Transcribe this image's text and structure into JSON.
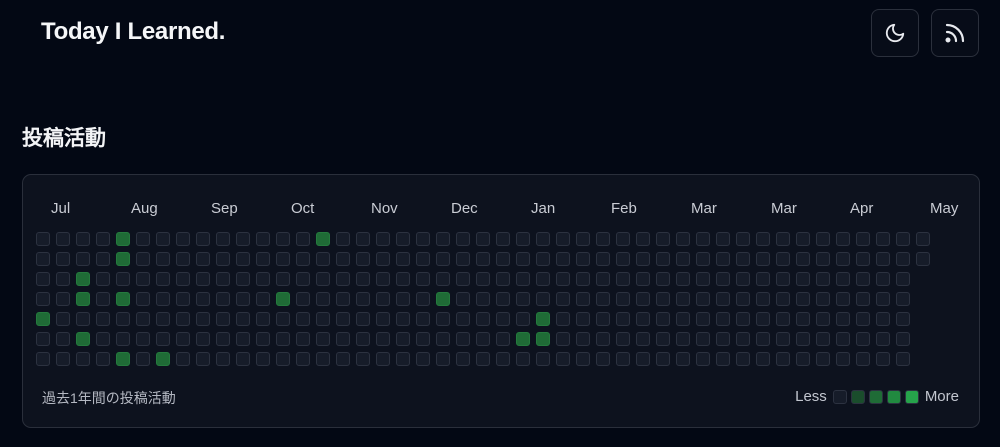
{
  "header": {
    "site_title": "Today I Learned.",
    "theme_toggle_icon": "moon-icon",
    "rss_icon": "rss-icon"
  },
  "section": {
    "title": "投稿活動"
  },
  "activity": {
    "months": [
      "Jul",
      "Aug",
      "Sep",
      "Oct",
      "Nov",
      "Dec",
      "Jan",
      "Feb",
      "Mar",
      "Mar",
      "Apr",
      "May"
    ],
    "caption": "過去1年間の投稿活動",
    "legend_less": "Less",
    "legend_more": "More",
    "colors": {
      "empty": "#161c29",
      "level1": "#1a4d2c",
      "level2": "#1f6b36",
      "level3": "#218a40",
      "level4": "#26a34b"
    },
    "active_days": [
      {
        "week": 4,
        "day": 0,
        "level": 2
      },
      {
        "week": 4,
        "day": 1,
        "level": 2
      },
      {
        "week": 2,
        "day": 2,
        "level": 2
      },
      {
        "week": 2,
        "day": 3,
        "level": 2
      },
      {
        "week": 4,
        "day": 3,
        "level": 2
      },
      {
        "week": 0,
        "day": 4,
        "level": 2
      },
      {
        "week": 2,
        "day": 5,
        "level": 2
      },
      {
        "week": 4,
        "day": 6,
        "level": 2
      },
      {
        "week": 6,
        "day": 6,
        "level": 2
      },
      {
        "week": 12,
        "day": 3,
        "level": 2
      },
      {
        "week": 14,
        "day": 0,
        "level": 2
      },
      {
        "week": 20,
        "day": 3,
        "level": 2
      },
      {
        "week": 25,
        "day": 4,
        "level": 2
      },
      {
        "week": 24,
        "day": 5,
        "level": 2
      },
      {
        "week": 25,
        "day": 5,
        "level": 2
      }
    ]
  }
}
